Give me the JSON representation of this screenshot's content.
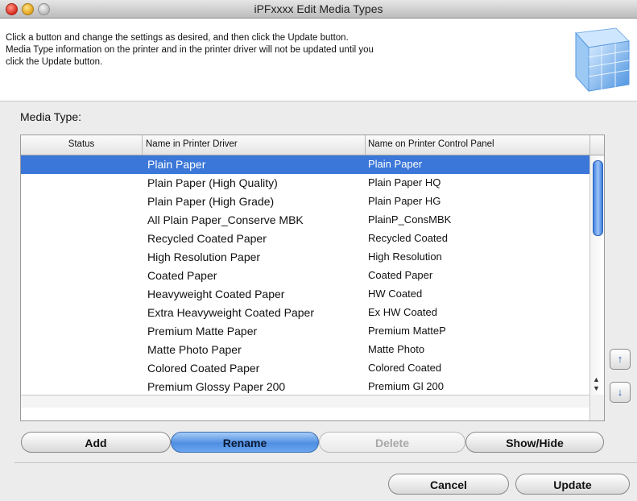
{
  "window": {
    "title": "iPFxxxx Edit Media Types"
  },
  "info": {
    "lines": [
      "Click a button and change the settings as desired, and then click the Update button.",
      "Media Type information on the printer and in the printer driver will not be updated until you",
      "click the Update button."
    ],
    "graphic_icon": "media-stack-icon"
  },
  "media_type_label": "Media Type:",
  "table": {
    "columns": [
      "Status",
      "Name in Printer Driver",
      "Name on Printer Control Panel"
    ],
    "selected_index": 0,
    "rows": [
      {
        "status": "",
        "driver_name": "Plain Paper",
        "panel_name": "Plain Paper"
      },
      {
        "status": "",
        "driver_name": "Plain Paper (High Quality)",
        "panel_name": "Plain Paper HQ"
      },
      {
        "status": "",
        "driver_name": "Plain Paper (High Grade)",
        "panel_name": "Plain Paper HG"
      },
      {
        "status": "",
        "driver_name": "All Plain Paper_Conserve MBK",
        "panel_name": "PlainP_ConsMBK"
      },
      {
        "status": "",
        "driver_name": "Recycled Coated Paper",
        "panel_name": "Recycled Coated"
      },
      {
        "status": "",
        "driver_name": "High Resolution Paper",
        "panel_name": "High Resolution"
      },
      {
        "status": "",
        "driver_name": "Coated Paper",
        "panel_name": "Coated Paper"
      },
      {
        "status": "",
        "driver_name": "Heavyweight Coated Paper",
        "panel_name": "HW Coated"
      },
      {
        "status": "",
        "driver_name": "Extra Heavyweight Coated Paper",
        "panel_name": "Ex HW Coated"
      },
      {
        "status": "",
        "driver_name": "Premium Matte Paper",
        "panel_name": "Premium MatteP"
      },
      {
        "status": "",
        "driver_name": "Matte Photo Paper",
        "panel_name": "Matte Photo"
      },
      {
        "status": "",
        "driver_name": "Colored Coated Paper",
        "panel_name": "Colored Coated"
      },
      {
        "status": "",
        "driver_name": "Premium Glossy Paper 200",
        "panel_name": "Premium Gl 200"
      }
    ]
  },
  "side_buttons": {
    "move_up_icon": "move-up-icon",
    "move_down_icon": "move-down-icon"
  },
  "buttons": {
    "add": "Add",
    "rename": "Rename",
    "delete": "Delete",
    "show_hide": "Show/Hide",
    "cancel": "Cancel",
    "update": "Update"
  },
  "colors": {
    "selection": "#3b77d8",
    "scroll_thumb": "#3d7fe2"
  }
}
